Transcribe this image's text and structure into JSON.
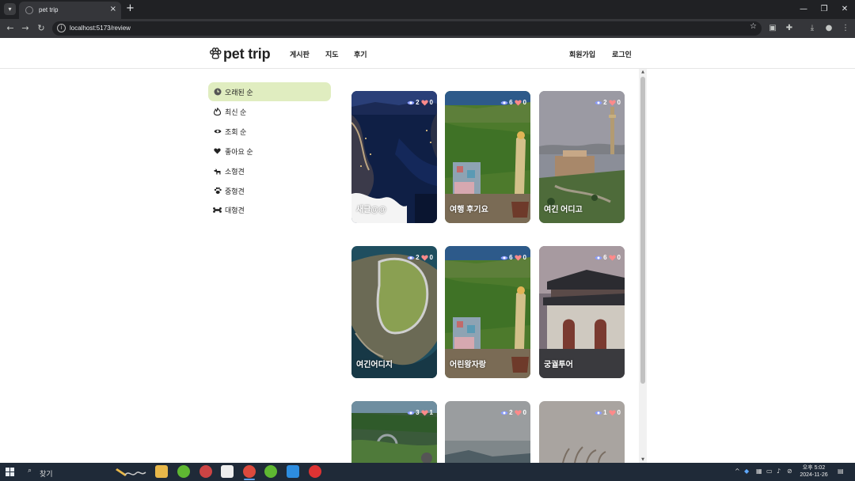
{
  "browser": {
    "tab_title": "pet trip",
    "tab_close": "×",
    "new_tab": "+",
    "url": "localhost:5173/review",
    "window_controls": [
      "—",
      "❐",
      "✕"
    ],
    "icons": [
      "back-icon",
      "forward-icon",
      "reload-icon",
      "info-icon",
      "star-icon",
      "sidebar-icon",
      "extensions-icon",
      "download-icon",
      "profile-icon",
      "menu-icon"
    ]
  },
  "header": {
    "logo_text": "pet trip",
    "nav": [
      "게시판",
      "지도",
      "후기"
    ],
    "auth": [
      "회원가입",
      "로그인"
    ]
  },
  "sidebar": {
    "items": [
      {
        "label": "오래된 순",
        "icon": "clock-icon",
        "active": true
      },
      {
        "label": "최신 순",
        "icon": "fire-icon",
        "active": false
      },
      {
        "label": "조회 순",
        "icon": "eye-icon",
        "active": false
      },
      {
        "label": "좋아요 순",
        "icon": "heart-icon",
        "active": false
      },
      {
        "label": "소형견",
        "icon": "small-dog-icon",
        "active": false
      },
      {
        "label": "중형견",
        "icon": "paw-icon",
        "active": false
      },
      {
        "label": "대형견",
        "icon": "bone-icon",
        "active": false
      }
    ]
  },
  "cards": [
    {
      "title": "새글@@",
      "views": "2",
      "likes": "0",
      "scene": "night-harbor"
    },
    {
      "title": "여행 후기요",
      "views": "6",
      "likes": "0",
      "scene": "hillside-village"
    },
    {
      "title": "여긴 어디고",
      "views": "2",
      "likes": "0",
      "scene": "tower-park"
    },
    {
      "title": "여긴어디지",
      "views": "2",
      "likes": "0",
      "scene": "coastal-road"
    },
    {
      "title": "어린왕자랑",
      "views": "6",
      "likes": "0",
      "scene": "hillside-village"
    },
    {
      "title": "궁궐투어",
      "views": "6",
      "likes": "0",
      "scene": "palace-gate"
    },
    {
      "title": "",
      "views": "3",
      "likes": "1",
      "scene": "bridge-forest"
    },
    {
      "title": "",
      "views": "2",
      "likes": "0",
      "scene": "grey-sea"
    },
    {
      "title": "",
      "views": "1",
      "likes": "0",
      "scene": "reeds"
    }
  ],
  "taskbar": {
    "search_placeholder": "찾기",
    "apps": [
      "file-explorer-icon",
      "spring-icon",
      "app-icon",
      "notion-icon",
      "chrome-icon",
      "spring-tool-icon",
      "vscode-icon",
      "recorder-icon"
    ],
    "time": "오후 5:02",
    "date": "2024-11-26"
  },
  "colors": {
    "sidebar_active": "#e0edc0",
    "eye_icon": "#8a9cff",
    "heart_icon": "#ff8a8a"
  }
}
